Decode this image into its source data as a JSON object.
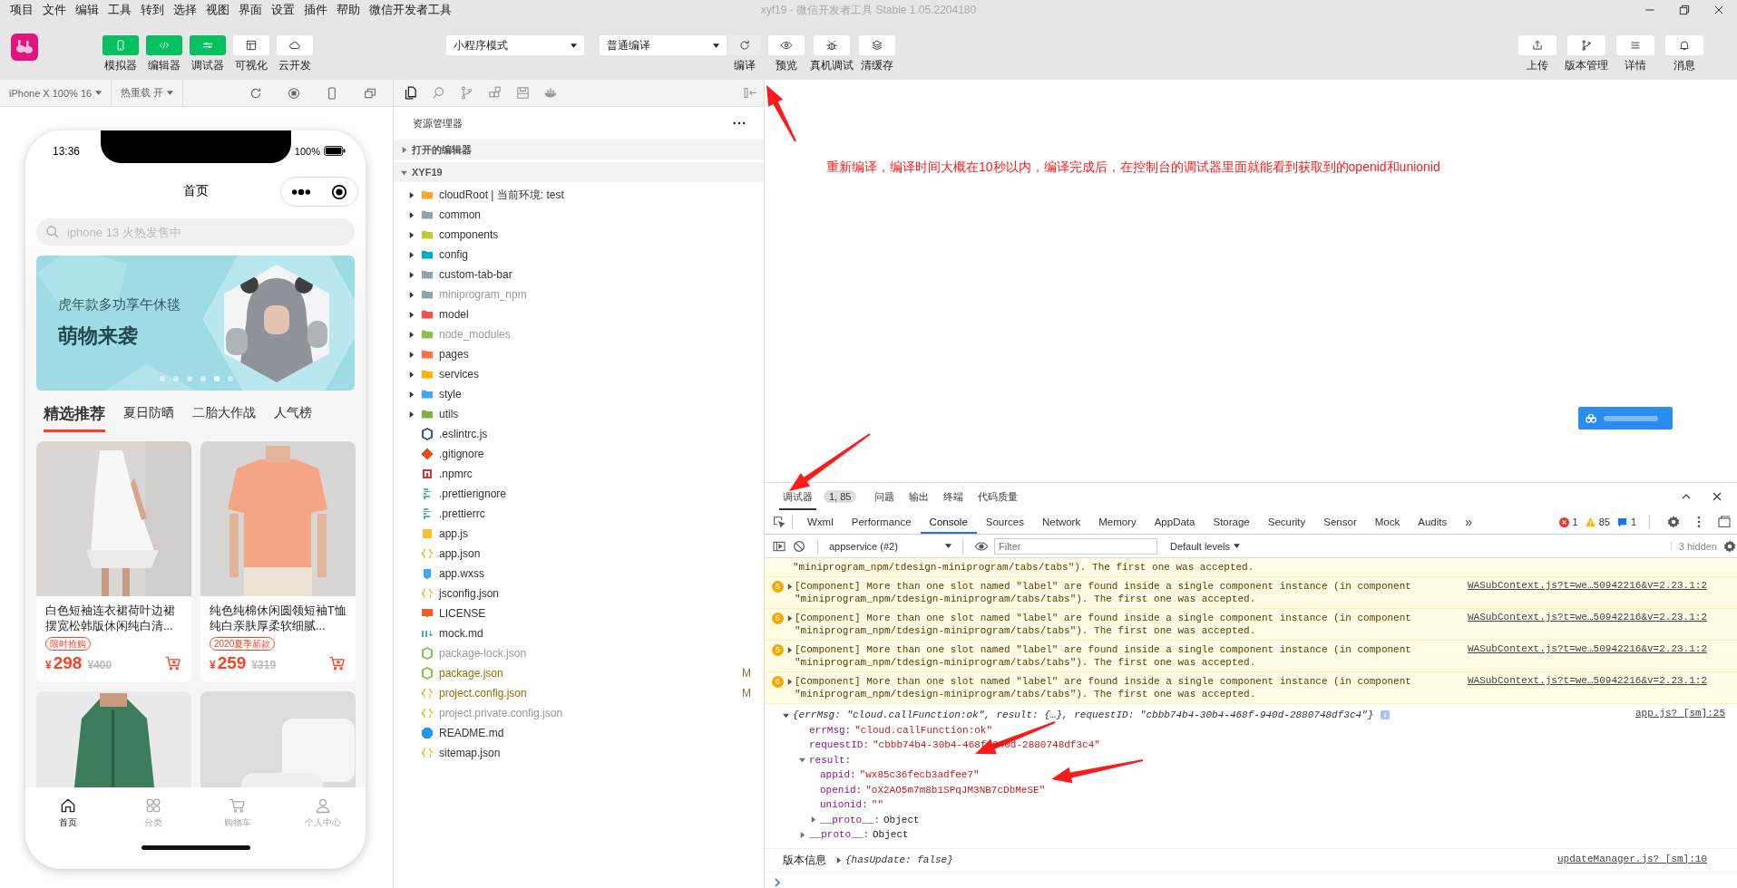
{
  "menu": [
    "项目",
    "文件",
    "编辑",
    "工具",
    "转到",
    "选择",
    "视图",
    "界面",
    "设置",
    "插件",
    "帮助",
    "微信开发者工具"
  ],
  "window_title": "xyf19 - 微信开发者工具 Stable 1.05.2204180",
  "toolbar": {
    "left": [
      {
        "label": "模拟器",
        "kind": "phone",
        "selected": true
      },
      {
        "label": "编辑器",
        "kind": "code",
        "selected": true
      },
      {
        "label": "调试器",
        "kind": "sliders",
        "selected": true
      },
      {
        "label": "可视化",
        "kind": "layout",
        "selected": false
      },
      {
        "label": "云开发",
        "kind": "cloud",
        "selected": false
      }
    ],
    "mode_select": "小程序模式",
    "compile_select": "普通编译",
    "center": [
      {
        "label": "编译",
        "kind": "refresh"
      },
      {
        "label": "预览",
        "kind": "eye"
      },
      {
        "label": "真机调试",
        "kind": "bug"
      },
      {
        "label": "清缓存",
        "kind": "layers"
      }
    ],
    "right": [
      {
        "label": "上传",
        "kind": "upload"
      },
      {
        "label": "版本管理",
        "kind": "branch"
      },
      {
        "label": "详情",
        "kind": "menu"
      },
      {
        "label": "消息",
        "kind": "bell"
      }
    ]
  },
  "simulator": {
    "device": "iPhone X 100% 16",
    "hot_reload": "热重载 开",
    "phone": {
      "time": "13:36",
      "battery": "100%",
      "title": "首页",
      "search_placeholder": "iphone 13 火热发售中",
      "banner": {
        "subtitle": "虎年款多功享午休毯",
        "title": "萌物来袭",
        "dots": [
          {
            "selected": false
          },
          {
            "selected": false
          },
          {
            "selected": false
          },
          {
            "selected": false
          },
          {
            "selected": true
          },
          {
            "selected": false
          }
        ]
      },
      "categories": [
        {
          "label": "精选推荐",
          "selected": true
        },
        {
          "label": "夏日防晒",
          "selected": false
        },
        {
          "label": "二胎大作战",
          "selected": false
        },
        {
          "label": "人气榜",
          "selected": false
        }
      ],
      "products": [
        {
          "image": {
            "kind": "picture"
          },
          "name": "白色短袖连衣裙荷叶边裙摆宽松韩版休闲纯白清...",
          "tag": "限时抢购",
          "currency": "¥",
          "price": "298",
          "original_price": "¥400"
        },
        {
          "image": {
            "kind": "picture"
          },
          "name": "纯色纯棉休闲圆领短袖T恤纯白亲肤厚柔软细腻...",
          "tag": "2020夏季新款",
          "currency": "¥",
          "price": "259",
          "original_price": "¥319"
        },
        {
          "image": {
            "kind": "picture"
          }
        },
        {
          "image": {
            "kind": "picture"
          }
        }
      ],
      "tabbar": [
        {
          "label": "首页",
          "kind": "home",
          "selected": true
        },
        {
          "label": "分类",
          "kind": "grid",
          "selected": false
        },
        {
          "label": "购物车",
          "kind": "cart",
          "selected": false
        },
        {
          "label": "个人中心",
          "kind": "user",
          "selected": false
        }
      ]
    }
  },
  "explorer": {
    "title": "资源管理器",
    "sections": [
      {
        "label": "打开的编辑器",
        "expanded": false
      },
      {
        "label": "XYF19",
        "expanded": true,
        "children": [
          {
            "label": "cloudRoot | 当前环境: test",
            "kind": "folder",
            "color": "#f9a825",
            "dimmed": false
          },
          {
            "label": "common",
            "kind": "folder",
            "color": "#90a4ae",
            "dimmed": false
          },
          {
            "label": "components",
            "kind": "folder",
            "color": "#c0ca33",
            "dimmed": false
          },
          {
            "label": "config",
            "kind": "folder",
            "color": "#00acc1",
            "dimmed": false
          },
          {
            "label": "custom-tab-bar",
            "kind": "folder",
            "color": "#90a4ae",
            "dimmed": false
          },
          {
            "label": "miniprogram_npm",
            "kind": "folder",
            "color": "#90a4ae",
            "dimmed": true
          },
          {
            "label": "model",
            "kind": "folder",
            "color": "#ef5350",
            "dimmed": false
          },
          {
            "label": "node_modules",
            "kind": "folder",
            "color": "#8bc34a",
            "dimmed": true
          },
          {
            "label": "pages",
            "kind": "folder",
            "color": "#ff7043",
            "dimmed": false
          },
          {
            "label": "services",
            "kind": "folder",
            "color": "#ffb300",
            "dimmed": false
          },
          {
            "label": "style",
            "kind": "folder",
            "color": "#42a5f5",
            "dimmed": false
          },
          {
            "label": "utils",
            "kind": "folder",
            "color": "#7cb342",
            "dimmed": false
          },
          {
            "label": ".eslintrc.js",
            "kind": "eslint",
            "color": "#3f51b5",
            "dimmed": false
          },
          {
            "label": ".gitignore",
            "kind": "git",
            "color": "#e64a19",
            "dimmed": false
          },
          {
            "label": ".npmrc",
            "kind": "npm",
            "color": "#cb3837",
            "dimmed": false
          },
          {
            "label": ".prettierignore",
            "kind": "prettier",
            "color": "#56b3b4",
            "dimmed": false
          },
          {
            "label": ".prettierrc",
            "kind": "prettier",
            "color": "#56b3b4",
            "dimmed": false
          },
          {
            "label": "app.js",
            "kind": "js",
            "color": "#fbc02d",
            "dimmed": false
          },
          {
            "label": "app.json",
            "kind": "json",
            "color": "#fbc02d",
            "dimmed": false
          },
          {
            "label": "app.wxss",
            "kind": "css",
            "color": "#42a5f5",
            "dimmed": false
          },
          {
            "label": "jsconfig.json",
            "kind": "json",
            "color": "#fbc02d",
            "dimmed": false
          },
          {
            "label": "LICENSE",
            "kind": "license",
            "color": "#ff5722",
            "dimmed": false
          },
          {
            "label": "mock.md",
            "kind": "markdown",
            "color": "#42a5f5",
            "dimmed": false
          },
          {
            "label": "package-lock.json",
            "kind": "node",
            "color": "#8bc34a",
            "dimmed": true
          },
          {
            "label": "package.json",
            "kind": "node",
            "color": "#8bc34a",
            "dimmed": false,
            "badge": "M"
          },
          {
            "label": "project.config.json",
            "kind": "json",
            "color": "#fbc02d",
            "dimmed": false,
            "badge": "M"
          },
          {
            "label": "project.private.config.json",
            "kind": "json",
            "color": "#fbc02d",
            "dimmed": true
          },
          {
            "label": "README.md",
            "kind": "info",
            "color": "#2196f3",
            "dimmed": false
          },
          {
            "label": "sitemap.json",
            "kind": "json",
            "color": "#fbc02d",
            "dimmed": false
          }
        ]
      }
    ]
  },
  "annotation": "重新编译，编译时间大概在10秒以内，编译完成后，在控制台的调试器里面就能看到获取到的openid和unionid",
  "devtools": {
    "panels": [
      {
        "label": "调试器",
        "selected": true,
        "badge": "1, 85"
      },
      {
        "label": "问题",
        "selected": false
      },
      {
        "label": "输出",
        "selected": false
      },
      {
        "label": "终端",
        "selected": false
      },
      {
        "label": "代码质量",
        "selected": false
      }
    ],
    "tabs": [
      {
        "label": "Wxml",
        "selected": false
      },
      {
        "label": "Performance",
        "selected": false
      },
      {
        "label": "Console",
        "selected": true
      },
      {
        "label": "Sources",
        "selected": false
      },
      {
        "label": "Network",
        "selected": false
      },
      {
        "label": "Memory",
        "selected": false
      },
      {
        "label": "AppData",
        "selected": false
      },
      {
        "label": "Storage",
        "selected": false
      },
      {
        "label": "Security",
        "selected": false
      },
      {
        "label": "Sensor",
        "selected": false
      },
      {
        "label": "Mock",
        "selected": false
      },
      {
        "label": "Audits",
        "selected": false
      }
    ],
    "more_tabs": "»",
    "errors": "1",
    "warnings": "85",
    "infos": "1",
    "context": "appservice (#2)",
    "filter_placeholder": "Filter",
    "levels": "Default levels",
    "hidden": "3 hidden",
    "messages": [
      {
        "kind": "warning",
        "lines": [
          "\"miniprogram_npm/tdesign-miniprogram/tabs/tabs\"). The first one was accepted."
        ]
      },
      {
        "kind": "warning",
        "count": "5",
        "lines": [
          "[Component] More than one slot named \"label\" are found inside a single component instance (in component",
          "\"miniprogram_npm/tdesign-miniprogram/tabs/tabs\"). The first one was accepted."
        ],
        "source": "WASubContext.js?t=we…50942216&v=2.23.1:2"
      },
      {
        "kind": "warning",
        "count": "5",
        "lines": [
          "[Component] More than one slot named \"label\" are found inside a single component instance (in component",
          "\"miniprogram_npm/tdesign-miniprogram/tabs/tabs\"). The first one was accepted."
        ],
        "source": "WASubContext.js?t=we…50942216&v=2.23.1:2"
      },
      {
        "kind": "warning",
        "count": "5",
        "lines": [
          "[Component] More than one slot named \"label\" are found inside a single component instance (in component",
          "\"miniprogram_npm/tdesign-miniprogram/tabs/tabs\"). The first one was accepted."
        ],
        "source": "WASubContext.js?t=we…50942216&v=2.23.1:2"
      },
      {
        "kind": "warning",
        "count": "6",
        "lines": [
          "[Component] More than one slot named \"label\" are found inside a single component instance (in component",
          "\"miniprogram_npm/tdesign-miniprogram/tabs/tabs\"). The first one was accepted."
        ],
        "source": "WASubContext.js?t=we…50942216&v=2.23.1:2"
      },
      {
        "kind": "object",
        "expanded": true,
        "source": "app.js? [sm]:25",
        "summary": "{errMsg: \"cloud.callFunction:ok\", result: {…}, requestID: \"cbbb74b4-30b4-468f-940d-2880748df3c4\"}",
        "children": [
          {
            "kind": "leaf",
            "key": "errMsg:",
            "value": "\"cloud.callFunction:ok\""
          },
          {
            "kind": "leaf",
            "key": "requestID:",
            "value": "\"cbbb74b4-30b4-468f-940d-2880748df3c4\""
          },
          {
            "kind": "group",
            "key": "result:",
            "expanded": true,
            "children": [
              {
                "kind": "leaf",
                "key": "appid:",
                "value": "\"wx85c36fecb3adfee7\""
              },
              {
                "kind": "leaf",
                "key": "openid:",
                "value": "\"oX2AO5m7m8b1SPqJM3NB7cDbMeSE\""
              },
              {
                "kind": "leaf",
                "key": "unionid:",
                "value": "\"\""
              },
              {
                "kind": "group",
                "key": "__proto__:",
                "value": "Object",
                "expanded": false
              }
            ]
          },
          {
            "kind": "group",
            "key": "__proto__:",
            "value": "Object",
            "expanded": false
          }
        ]
      },
      {
        "kind": "log",
        "label": "版本信息",
        "expanded": false,
        "source": "updateManager.js? [sm]:10",
        "summary": "{hasUpdate: false}"
      }
    ]
  }
}
